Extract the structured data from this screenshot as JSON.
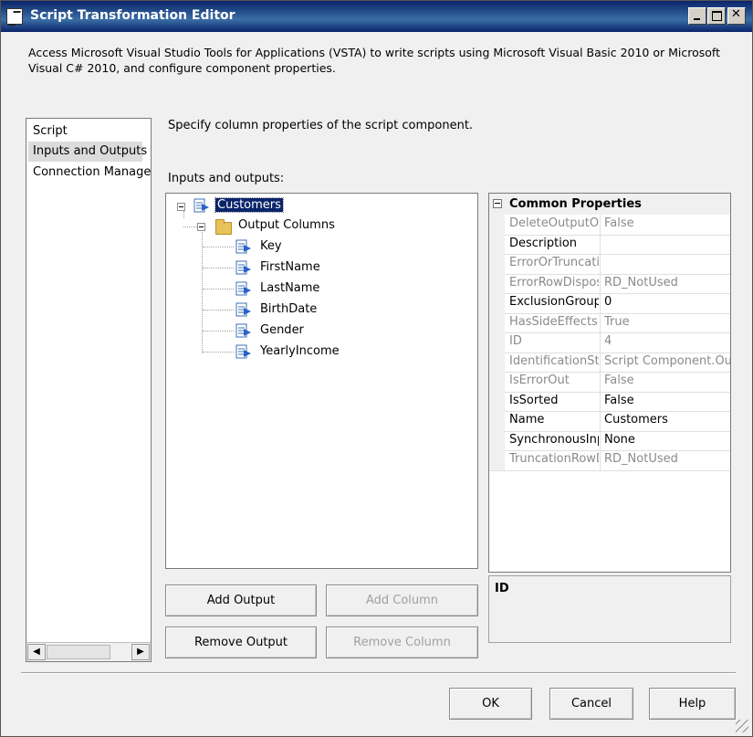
{
  "window": {
    "title": "Script Transformation Editor"
  },
  "description": "Access Microsoft Visual Studio Tools for Applications (VSTA) to write scripts using Microsoft Visual Basic 2010 or Microsoft Visual C# 2010, and configure component properties.",
  "nav": {
    "items": [
      {
        "label": "Script",
        "selected": false
      },
      {
        "label": "Inputs and Outputs",
        "selected": true
      },
      {
        "label": "Connection Managers",
        "selected": false
      }
    ]
  },
  "main": {
    "instruction": "Specify column properties of the script component.",
    "tree_label": "Inputs and outputs:",
    "tree": {
      "root": "Customers",
      "folder": "Output Columns",
      "columns": [
        "Key",
        "FirstName",
        "LastName",
        "BirthDate",
        "Gender",
        "YearlyIncome"
      ]
    }
  },
  "properties": {
    "category": "Common Properties",
    "rows": [
      {
        "name": "DeleteOutputOnPathDetached",
        "value": "False",
        "readonly": true
      },
      {
        "name": "Description",
        "value": "",
        "readonly": false
      },
      {
        "name": "ErrorOrTruncationOperation",
        "value": "",
        "readonly": true
      },
      {
        "name": "ErrorRowDisposition",
        "value": "RD_NotUsed",
        "readonly": true
      },
      {
        "name": "ExclusionGroup",
        "value": "0",
        "readonly": false
      },
      {
        "name": "HasSideEffects",
        "value": "True",
        "readonly": true
      },
      {
        "name": "ID",
        "value": "4",
        "readonly": true
      },
      {
        "name": "IdentificationString",
        "value": "Script Component.Outputs[Customers]",
        "readonly": true
      },
      {
        "name": "IsErrorOut",
        "value": "False",
        "readonly": true
      },
      {
        "name": "IsSorted",
        "value": "False",
        "readonly": false
      },
      {
        "name": "Name",
        "value": "Customers",
        "readonly": false
      },
      {
        "name": "SynchronousInputID",
        "value": "None",
        "readonly": false
      },
      {
        "name": "TruncationRowDisposition",
        "value": "RD_NotUsed",
        "readonly": true
      }
    ],
    "description_title": "ID"
  },
  "buttons": {
    "add_output": "Add Output",
    "add_column": "Add Column",
    "remove_output": "Remove Output",
    "remove_column": "Remove Column",
    "ok": "OK",
    "cancel": "Cancel",
    "help": "Help"
  }
}
